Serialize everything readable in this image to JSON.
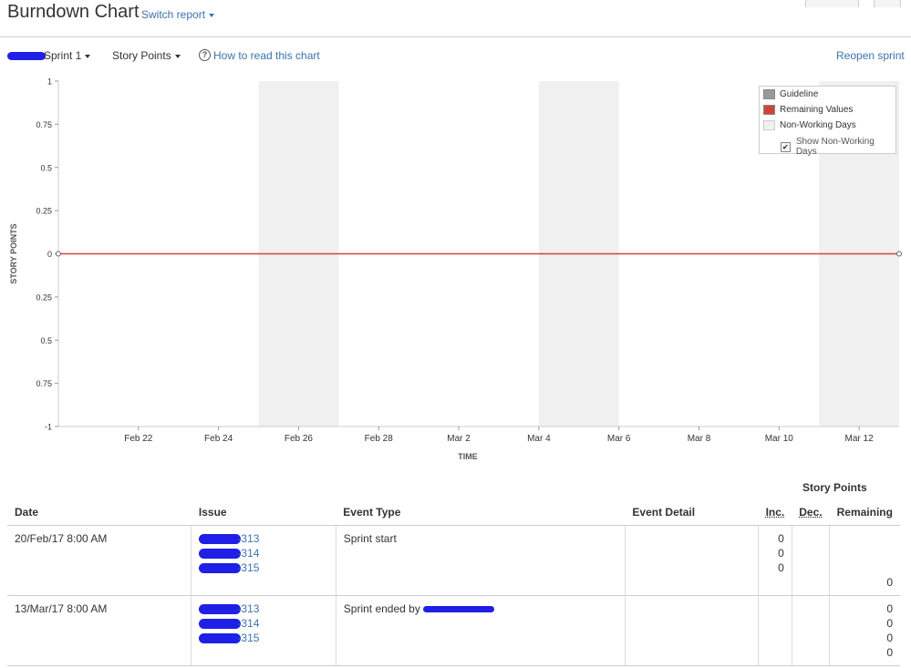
{
  "header": {
    "title": "Burndown Chart",
    "switch_report": "Switch report"
  },
  "toolbar": {
    "sprint": "Sprint 1",
    "statistic": "Story Points",
    "help_link": "How to read this chart",
    "reopen": "Reopen sprint"
  },
  "chart_data": {
    "type": "line",
    "ylabel": "STORY POINTS",
    "xlabel": "TIME",
    "ylim": [
      -1,
      1
    ],
    "y_tick_labels": [
      "1",
      "0.75",
      "0.5",
      "0.25",
      "0",
      "0.25",
      "0.5",
      "0.75",
      "-1"
    ],
    "x_tick_labels": [
      "Feb 22",
      "Feb 24",
      "Feb 26",
      "Feb 28",
      "Mar 2",
      "Mar 4",
      "Mar 6",
      "Mar 8",
      "Mar 10",
      "Mar 12"
    ],
    "x_range": [
      "Feb 20",
      "Mar 13"
    ],
    "non_working_periods": [
      [
        "Feb 25",
        "Feb 27"
      ],
      [
        "Mar 4",
        "Mar 6"
      ],
      [
        "Mar 11",
        "Mar 13"
      ]
    ],
    "series": [
      {
        "name": "Guideline",
        "color": "#999999",
        "points": [
          [
            "Feb 20",
            0
          ],
          [
            "Mar 13",
            0
          ]
        ]
      },
      {
        "name": "Remaining Values",
        "color": "#d04437",
        "points": [
          [
            "Feb 20",
            0
          ],
          [
            "Mar 13",
            0
          ]
        ]
      }
    ],
    "legend": {
      "placement": "top-right",
      "items": [
        {
          "label": "Guideline",
          "color": "#999999"
        },
        {
          "label": "Remaining Values",
          "color": "#d04437"
        },
        {
          "label": "Non-Working Days",
          "color": "#f0f0f0"
        }
      ],
      "checkbox_label": "Show Non-Working Days",
      "checkbox_checked": true
    }
  },
  "table": {
    "group_header": "Story Points",
    "columns": {
      "date": "Date",
      "issue": "Issue",
      "event_type": "Event Type",
      "event_detail": "Event Detail",
      "inc": "Inc.",
      "dec": "Dec.",
      "remaining": "Remaining"
    },
    "rows": [
      {
        "date": "20/Feb/17 8:00 AM",
        "issues": [
          "-313",
          "-314",
          "-315"
        ],
        "event_type": "Sprint start",
        "event_detail": "",
        "inc": [
          "0",
          "0",
          "0"
        ],
        "dec": [],
        "remaining": [
          "",
          "",
          "",
          "0"
        ]
      },
      {
        "date": "13/Mar/17 8:00 AM",
        "issues": [
          "-313",
          "-314",
          "-315"
        ],
        "event_type": "Sprint ended by",
        "event_detail": "",
        "inc": [],
        "dec": [],
        "remaining": [
          "0",
          "0",
          "0",
          "0"
        ]
      }
    ]
  }
}
